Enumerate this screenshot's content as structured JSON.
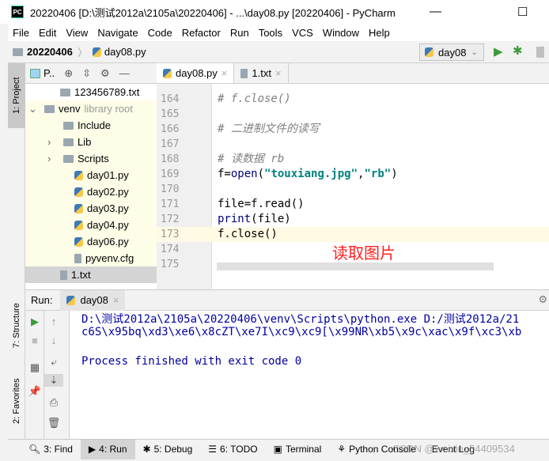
{
  "window": {
    "title": "20220406 [D:\\测试2012a\\2105a\\20220406] - ...\\day08.py [20220406] - PyCharm",
    "logo": "PC",
    "minimize": "—",
    "maximize": "☐"
  },
  "menu": [
    "File",
    "Edit",
    "View",
    "Navigate",
    "Code",
    "Refactor",
    "Run",
    "Tools",
    "VCS",
    "Window",
    "Help"
  ],
  "navbar": {
    "project": "20220406",
    "file": "day08.py",
    "run_config": "day08"
  },
  "left_stripe": {
    "project": "1: Project",
    "structure": "7: Structure",
    "favorites": "2: Favorites"
  },
  "project": {
    "view_label": "P..",
    "tree": [
      {
        "label": "123456789.txt",
        "type": "folder"
      },
      {
        "label": "venv",
        "hint": "library root",
        "type": "folder",
        "expanded": true
      },
      {
        "label": "Include",
        "type": "folder"
      },
      {
        "label": "Lib",
        "type": "folder",
        "collapsed": true
      },
      {
        "label": "Scripts",
        "type": "folder",
        "collapsed": true
      },
      {
        "label": "day01.py",
        "type": "py"
      },
      {
        "label": "day02.py",
        "type": "py"
      },
      {
        "label": "day03.py",
        "type": "py"
      },
      {
        "label": "day04.py",
        "type": "py"
      },
      {
        "label": "day06.py",
        "type": "py"
      },
      {
        "label": "pyvenv.cfg",
        "type": "txt"
      },
      {
        "label": "1.txt",
        "type": "txt"
      }
    ]
  },
  "editor": {
    "tabs": [
      {
        "label": "day08.py",
        "active": true
      },
      {
        "label": "1.txt"
      }
    ],
    "lines": [
      {
        "n": "164",
        "text": "# f.close()"
      },
      {
        "n": "165",
        "text": ""
      },
      {
        "n": "166",
        "text": "# 二进制文件的读写"
      },
      {
        "n": "167",
        "text": ""
      },
      {
        "n": "168",
        "text": "# 读数据 rb"
      },
      {
        "n": "169",
        "pre": "f=",
        "kw": "open",
        "p1": "(",
        "s1": "\"touxiang.jpg\"",
        "p2": ",",
        "s2": "\"rb\"",
        "p3": ")"
      },
      {
        "n": "170",
        "text": ""
      },
      {
        "n": "171",
        "text": "file=f.read()"
      },
      {
        "n": "172",
        "kwp": "print",
        "text": "(file)"
      },
      {
        "n": "173",
        "text": "f.close()"
      },
      {
        "n": "174",
        "text": ""
      },
      {
        "n": "175",
        "text": ""
      }
    ],
    "annotation": "读取图片",
    "annotation_color": "#ff0000"
  },
  "run": {
    "label": "Run:",
    "tab": "day08",
    "output": [
      "D:\\测试2012a\\2105a\\20220406\\venv\\Scripts\\python.exe D:/测试2012a/21",
      "c6S\\x95bq\\xd3\\xe6\\x8cZT\\xe7I\\xc9\\xc9[\\x99NR\\xb5\\x9c\\xac\\x9f\\xc3\\xb",
      "",
      "Process finished with exit code 0"
    ]
  },
  "bottom": [
    "3: Find",
    "4: Run",
    "5: Debug",
    "6: TODO",
    "Terminal",
    "Python Console",
    "Event Log"
  ],
  "watermark": "CSDN @weixin_54409534"
}
